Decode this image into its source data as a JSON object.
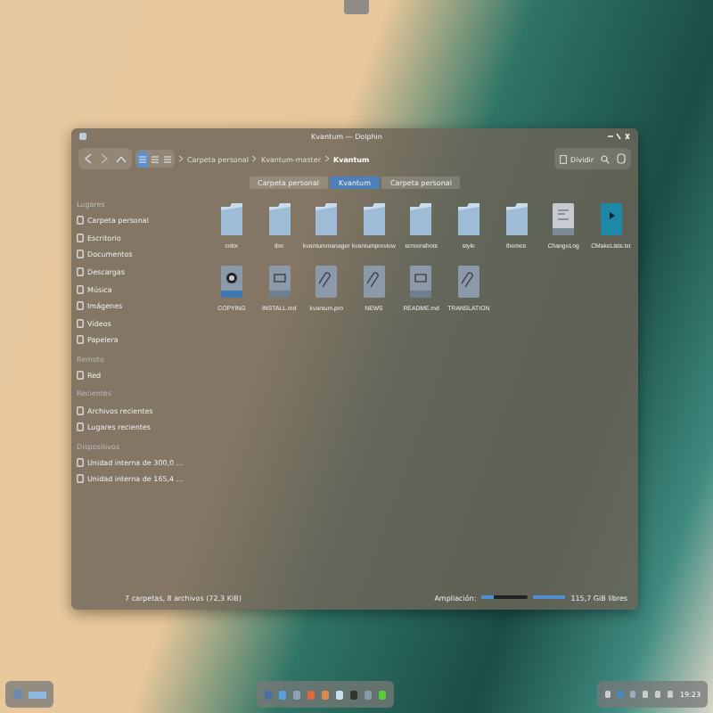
{
  "window": {
    "title": "Kvantum — Dolphin"
  },
  "toolbar": {
    "breadcrumbs": [
      "Carpeta personal",
      "Kvantum-master",
      "Kvantum"
    ],
    "split_button": "Dividir",
    "views": [
      {
        "selected": true
      },
      {
        "selected": false
      },
      {
        "selected": false
      }
    ]
  },
  "tabs": [
    {
      "label": "Carpeta personal",
      "selected": false
    },
    {
      "label": "Kvantum",
      "selected": true
    },
    {
      "label": "Carpeta personal",
      "selected": false
    }
  ],
  "sidebar": {
    "sections": [
      {
        "title": "Lugares",
        "items": [
          "Carpeta personal",
          "Escritorio",
          "Documentos",
          "Descargas",
          "Música",
          "Imágenes",
          "Vídeos",
          "Papelera"
        ]
      },
      {
        "title": "Remoto",
        "items": [
          "Red"
        ]
      },
      {
        "title": "Recientes",
        "items": [
          "Archivos recientes",
          "Lugares recientes"
        ]
      },
      {
        "title": "Dispositivos",
        "items": [
          "Unidad interna de 300,0 ...",
          "Unidad interna de 165,4 ..."
        ]
      }
    ]
  },
  "files": [
    {
      "name": "color",
      "kind": "folder"
    },
    {
      "name": "doc",
      "kind": "folder"
    },
    {
      "name": "kvantummanager",
      "kind": "folder"
    },
    {
      "name": "kvantumpreview",
      "kind": "folder"
    },
    {
      "name": "screenshots",
      "kind": "folder"
    },
    {
      "name": "style",
      "kind": "folder"
    },
    {
      "name": "themes",
      "kind": "folder"
    },
    {
      "name": "ChangeLog",
      "kind": "text"
    },
    {
      "name": "CMakeLists.txt",
      "kind": "cmake"
    },
    {
      "name": "COPYING",
      "kind": "license"
    },
    {
      "name": "INSTALL.md",
      "kind": "markdown"
    },
    {
      "name": "kvantum.pro",
      "kind": "attachment"
    },
    {
      "name": "NEWS",
      "kind": "attachment"
    },
    {
      "name": "README.md",
      "kind": "markdown"
    },
    {
      "name": "TRANSLATION",
      "kind": "attachment"
    }
  ],
  "status_bar": {
    "summary": "7 carpetas, 8 archivos (72,3 KiB)",
    "zoom_label": "Ampliación:",
    "zoom": {
      "level": 0.25
    },
    "free_space": "115,7 GiB libres"
  },
  "clock": {
    "time": "19:23"
  }
}
